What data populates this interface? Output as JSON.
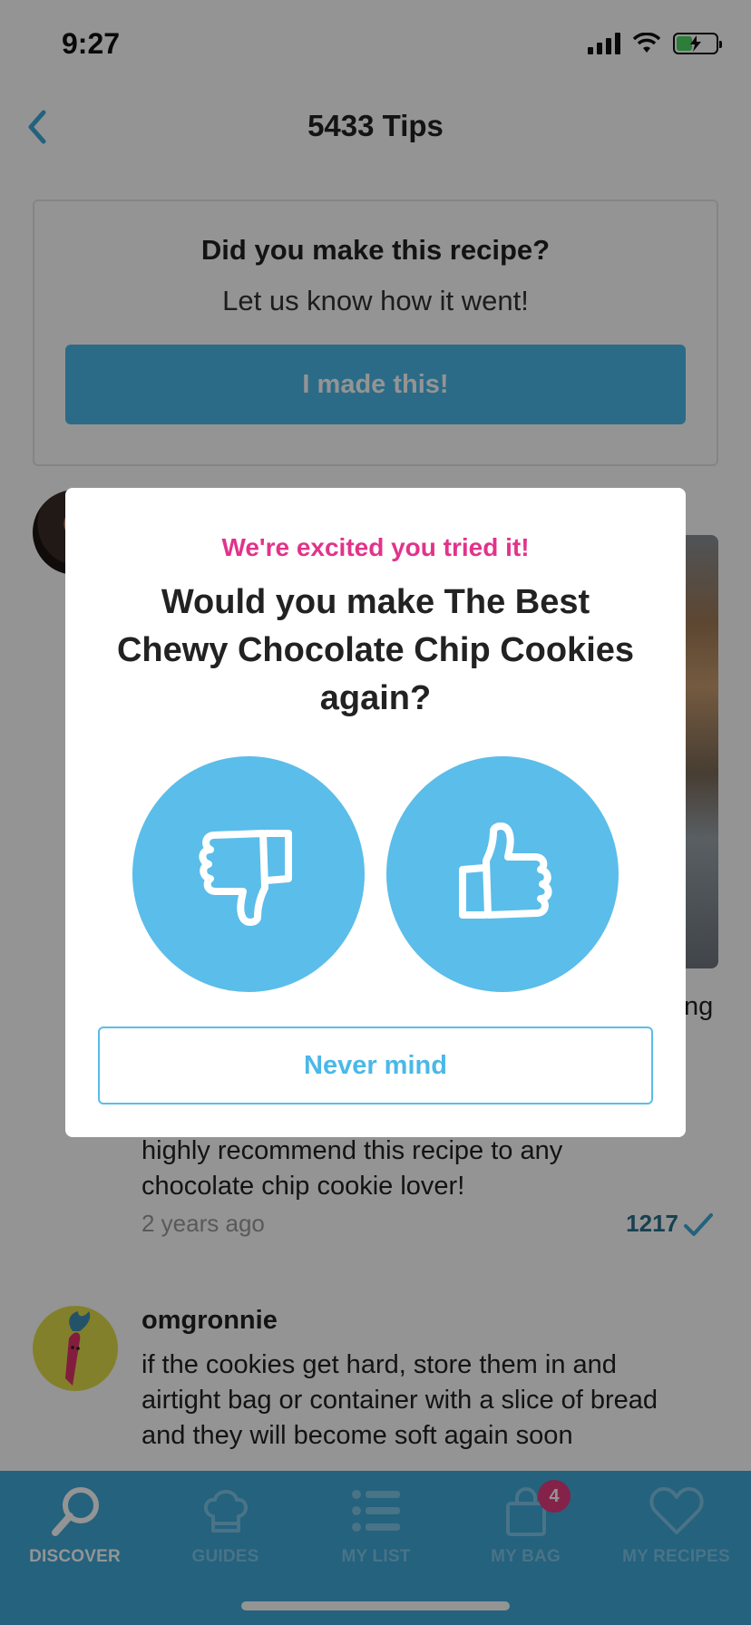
{
  "status_bar": {
    "time": "9:27"
  },
  "header": {
    "title": "5433 Tips"
  },
  "made_card": {
    "question": "Did you make this recipe?",
    "subtitle": "Let us know how it went!",
    "button_label": "I made this!"
  },
  "tips": [
    {
      "partial_right_text": "ng",
      "text_lines": [
        "highly recommend this recipe to any",
        "chocolate chip cookie lover!"
      ],
      "time": "2 years ago",
      "likes": "1217"
    },
    {
      "username": "omgronnie",
      "text_lines": [
        "if the cookies get hard, store them in and",
        "airtight bag or container with a slice of bread",
        "and they will become soft again soon"
      ]
    }
  ],
  "modal": {
    "kicker": "We're excited you tried it!",
    "question": "Would you make The Best Chewy Chocolate Chip Cookies again?",
    "thumbs_down_icon": "thumbs-down-icon",
    "thumbs_up_icon": "thumbs-up-icon",
    "dismiss_label": "Never mind"
  },
  "tabbar": {
    "tabs": [
      {
        "label": "DISCOVER",
        "icon": "search-icon",
        "active": true
      },
      {
        "label": "GUIDES",
        "icon": "chef-hat-icon",
        "active": false
      },
      {
        "label": "MY LIST",
        "icon": "list-icon",
        "active": false
      },
      {
        "label": "MY BAG",
        "icon": "bag-icon",
        "active": false,
        "badge": "4"
      },
      {
        "label": "MY RECIPES",
        "icon": "heart-icon",
        "active": false
      }
    ]
  },
  "colors": {
    "accent_blue": "#4ab8e8",
    "kicker_pink": "#e2338a",
    "tabbar_blue": "#3fa9d9",
    "badge": "#e33b7f"
  }
}
